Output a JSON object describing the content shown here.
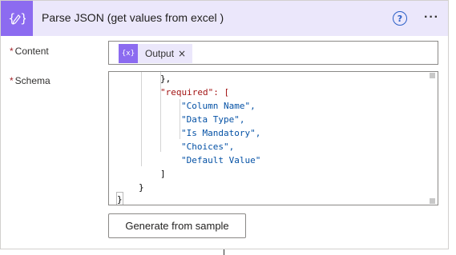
{
  "action": {
    "title": "Parse JSON (get values from excel )",
    "icon": "braces-edit-icon",
    "help_glyph": "?",
    "more_glyph": "···",
    "accent_color": "#8c6bf0",
    "header_bg": "#ebe7fb"
  },
  "fields": {
    "content": {
      "required_mark": "*",
      "label": "Content",
      "token": {
        "icon_text": "{x}",
        "label": "Output",
        "remove_glyph": "×"
      }
    },
    "schema": {
      "required_mark": "*",
      "label": "Schema",
      "code_lines": [
        "},",
        "\"required\": [",
        "\"Column Name\",",
        "\"Data Type\",",
        "\"Is Mandatory\",",
        "\"Choices\",",
        "\"Default Value\"",
        "]",
        "}",
        "}"
      ]
    }
  },
  "buttons": {
    "generate_label": "Generate from sample"
  }
}
